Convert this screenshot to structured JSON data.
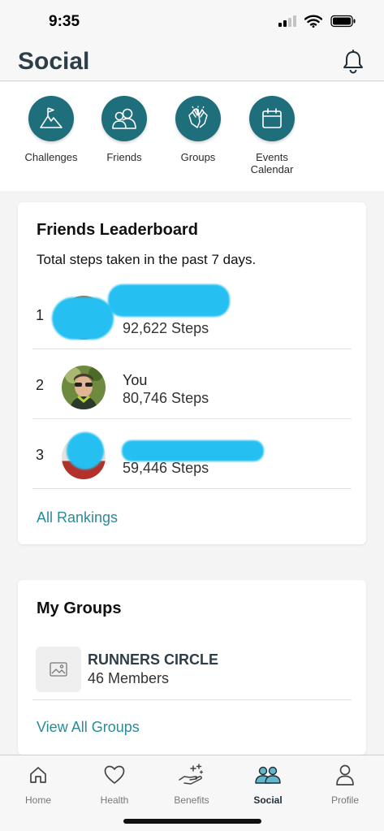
{
  "status_bar": {
    "time": "9:35"
  },
  "header": {
    "title": "Social"
  },
  "shortcuts": [
    {
      "label": "Challenges",
      "icon": "flag-mountain-icon"
    },
    {
      "label": "Friends",
      "icon": "people-icon"
    },
    {
      "label": "Groups",
      "icon": "high-five-icon"
    },
    {
      "label": "Events\nCalendar",
      "icon": "calendar-icon"
    }
  ],
  "leaderboard": {
    "title": "Friends Leaderboard",
    "subtitle": "Total steps taken in the past 7 days.",
    "rows": [
      {
        "rank": "1",
        "name": "",
        "steps": "92,622 Steps"
      },
      {
        "rank": "2",
        "name": "You",
        "steps": "80,746 Steps"
      },
      {
        "rank": "3",
        "name": "",
        "steps": "59,446 Steps"
      }
    ],
    "link": "All Rankings"
  },
  "groups": {
    "title": "My Groups",
    "items": [
      {
        "name": "RUNNERS CIRCLE",
        "members": "46 Members"
      }
    ],
    "link": "View All Groups"
  },
  "tabbar": {
    "tabs": [
      {
        "label": "Home",
        "icon": "home-icon"
      },
      {
        "label": "Health",
        "icon": "heart-icon"
      },
      {
        "label": "Benefits",
        "icon": "benefits-hand-icon"
      },
      {
        "label": "Social",
        "icon": "social-icon",
        "active": true
      },
      {
        "label": "Profile",
        "icon": "profile-icon"
      }
    ]
  },
  "colors": {
    "accent": "#1e6f7b",
    "link": "#2b8b99",
    "redaction": "#25bff1"
  }
}
